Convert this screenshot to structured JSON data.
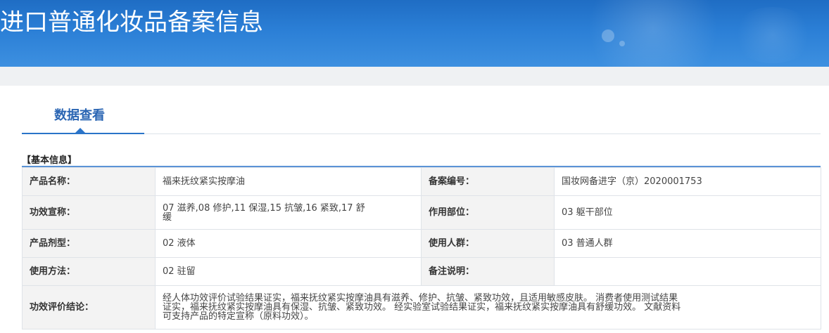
{
  "header": {
    "title": "进口普通化妆品备案信息"
  },
  "tabs": {
    "active_label": "数据查看"
  },
  "section": {
    "title": "【基本信息】"
  },
  "info": {
    "product_name_label": "产品名称：",
    "product_name_value": "福来抚纹紧实按摩油",
    "record_no_label": "备案编号：",
    "record_no_value": "国妆网备进字（京）2020001753",
    "efficacy_label": "功效宣称：",
    "efficacy_value": "07 滋养,08 修护,11 保湿,15 抗皱,16 紧致,17 舒缓",
    "body_part_label": "作用部位：",
    "body_part_value": "03 躯干部位",
    "dosage_form_label": "产品剂型：",
    "dosage_form_value": "02 液体",
    "user_group_label": "使用人群：",
    "user_group_value": "03 普通人群",
    "usage_label": "使用方法：",
    "usage_value": "02 驻留",
    "remarks_label": "备注说明：",
    "remarks_value": "",
    "conclusion_label": "功效评价结论：",
    "conclusion_value": "经人体功效评价试验结果证实，福来抚纹紧实按摩油具有滋养、修护、抗皱、紧致功效，且适用敏感皮肤。 消费者使用测试结果证实，福来抚纹紧实按摩油具有保湿、抗皱、紧致功效。 经实验室试验结果证实，福来抚纹紧实按摩油具有舒缓功效。 文献资料可支持产品的特定宣称（原料功效）。"
  }
}
